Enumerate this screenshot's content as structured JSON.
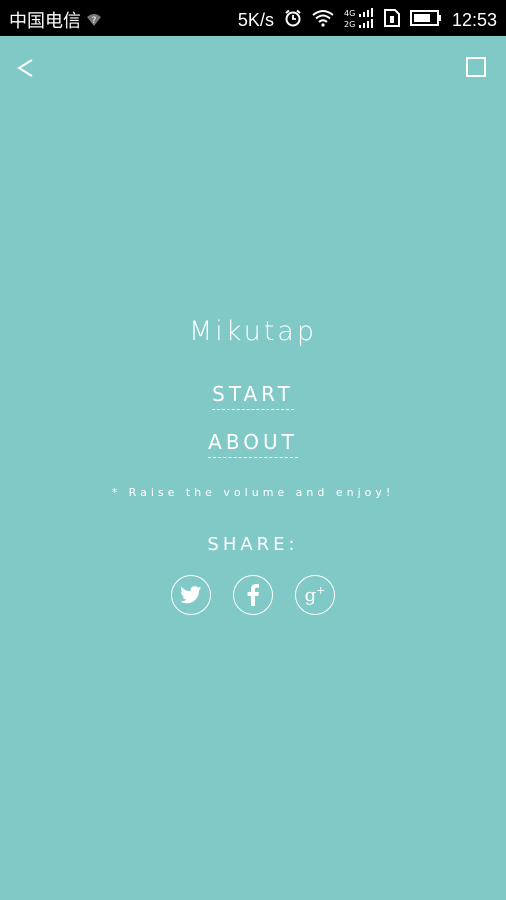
{
  "status_bar": {
    "carrier": "中国电信",
    "network_speed": "5K/s",
    "network_types": "4G 2G",
    "time": "12:53"
  },
  "app": {
    "title": "Mikutap",
    "menu": {
      "start_label": "START",
      "about_label": "ABOUT"
    },
    "hint": "* Raise the volume and enjoy!",
    "share_label": "SHARE:",
    "social": [
      {
        "name": "twitter",
        "icon": "twitter-icon"
      },
      {
        "name": "facebook",
        "icon": "facebook-icon",
        "glyph": "f"
      },
      {
        "name": "google-plus",
        "icon": "google-plus-icon",
        "glyph": "g+"
      }
    ],
    "colors": {
      "background": "#80c9c7",
      "foreground": "#ffffff",
      "status_bar": "#000000"
    }
  }
}
